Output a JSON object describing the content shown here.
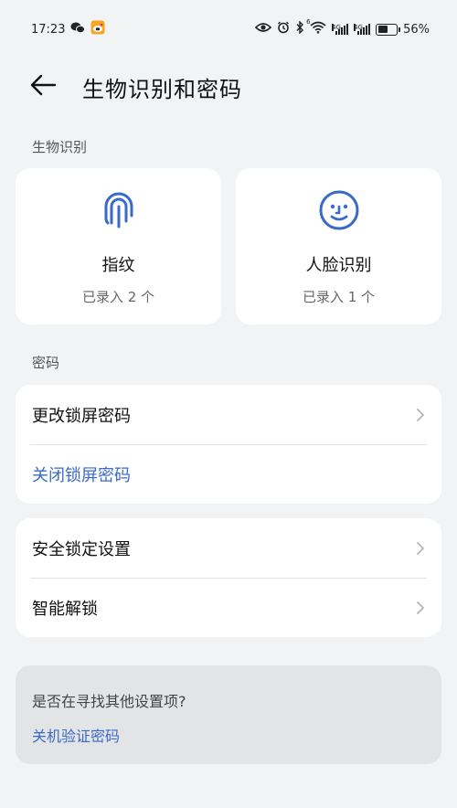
{
  "status_bar": {
    "time": "17:23",
    "network_1": "4G",
    "network_2": "4G",
    "wifi_sup": "6",
    "battery_percent": "56%",
    "battery_level": 0.56,
    "icons": [
      "wechat-icon",
      "weibo-icon",
      "eye-icon",
      "alarm-icon",
      "bluetooth-icon",
      "wifi-icon",
      "signal-icon",
      "battery-icon"
    ]
  },
  "header": {
    "title": "生物识别和密码"
  },
  "biometrics": {
    "section_label": "生物识别",
    "fingerprint": {
      "name": "指纹",
      "status": "已录入 2 个"
    },
    "face": {
      "name": "人脸识别",
      "status": "已录入 1 个"
    }
  },
  "password": {
    "section_label": "密码",
    "change_lock": "更改锁屏密码",
    "disable_lock": "关闭锁屏密码"
  },
  "security": {
    "lock_settings": "安全锁定设置",
    "smart_unlock": "智能解锁"
  },
  "suggest": {
    "question": "是否在寻找其他设置项?",
    "link": "关机验证密码"
  },
  "colors": {
    "accent": "#3A6AC8",
    "background": "#F1F3F5",
    "card": "#FFFFFF"
  }
}
